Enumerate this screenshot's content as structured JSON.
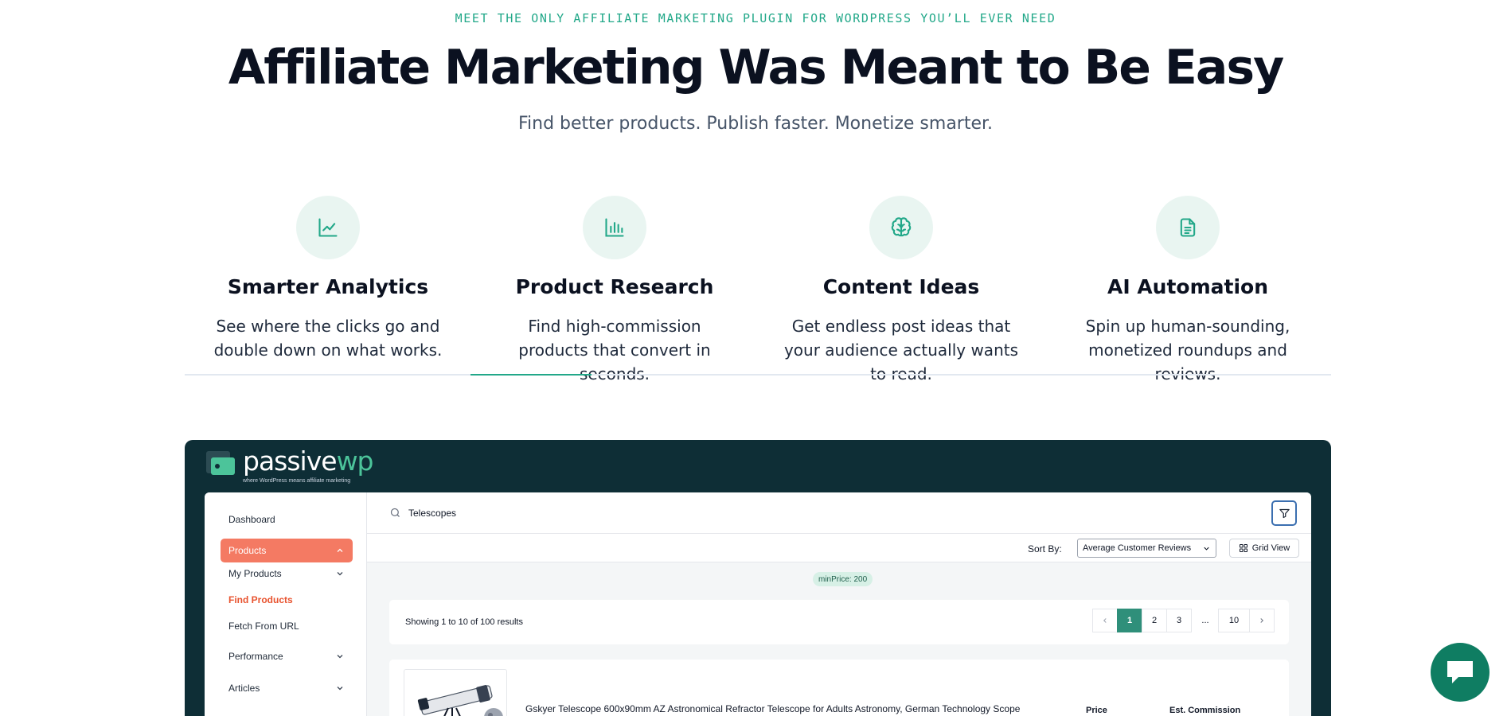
{
  "hero": {
    "eyebrow": "MEET THE ONLY AFFILIATE MARKETING PLUGIN FOR WORDPRESS YOU’LL EVER NEED",
    "title": "Affiliate Marketing Was Meant to Be Easy",
    "subtitle": "Find better products. Publish faster. Monetize smarter."
  },
  "features": [
    {
      "icon": "line-chart-icon",
      "title": "Smarter Analytics",
      "description": "See where the clicks go and double down on what works."
    },
    {
      "icon": "bar-chart-icon",
      "title": "Product Research",
      "description": "Find high-commission products that convert in seconds."
    },
    {
      "icon": "brain-icon",
      "title": "Content Ideas",
      "description": "Get endless post ideas that your audience actually wants to read."
    },
    {
      "icon": "document-icon",
      "title": "AI Automation",
      "description": "Spin up human-sounding, monetized roundups and reviews."
    }
  ],
  "features_active_tab": "Product Research",
  "app": {
    "logo": {
      "word_main": "passive",
      "word_accent": "wp",
      "tagline": "where WordPress means affiliate marketing"
    },
    "sidebar": {
      "dashboard": "Dashboard",
      "products": "Products",
      "my_products": "My Products",
      "find_products": "Find Products",
      "fetch_from_url": "Fetch From URL",
      "performance": "Performance",
      "articles": "Articles"
    },
    "search": {
      "value": "Telescopes"
    },
    "sort": {
      "label": "Sort By:",
      "value": "Average Customer Reviews",
      "grid_view": "Grid View"
    },
    "filter_chip": "minPrice: 200",
    "results": {
      "text": "Showing 1 to 10 of 100 results"
    },
    "pagination": {
      "pages": [
        "1",
        "2",
        "3"
      ],
      "ellipsis": "...",
      "last": "10",
      "current": "1"
    },
    "product": {
      "title": "Gskyer Telescope 600x90mm AZ Astronomical Refractor Telescope for Adults Astronomy, German Technology Scope",
      "col_price": "Price",
      "col_commission": "Est. Commission"
    }
  },
  "colors": {
    "accent": "#22a889",
    "brand_dark": "#0e2e36",
    "active_nav": "#f47a63",
    "chat": "#0f7d62"
  }
}
